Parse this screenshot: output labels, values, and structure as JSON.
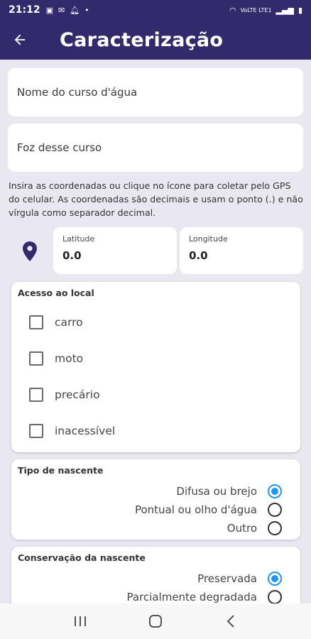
{
  "status_bar": {
    "time": "21:12",
    "network": "VoLTE LTE1"
  },
  "app_bar": {
    "title": "Caracterização",
    "back_icon": "arrow-left-icon"
  },
  "form": {
    "river_name_placeholder": "Nome do curso d'água",
    "mouth_placeholder": "Foz desse curso",
    "coordinates_info": "Insira as coordenadas ou clique no ícone para coletar pelo GPS do celular. As coordenadas são decimais e usam o ponto (.) e não vírgula como separador decimal.",
    "latitude": {
      "label": "Latitude",
      "value": "0.0"
    },
    "longitude": {
      "label": "Longitude",
      "value": "0.0"
    }
  },
  "access": {
    "title": "Acesso ao local",
    "options": [
      {
        "label": "carro",
        "checked": false
      },
      {
        "label": "moto",
        "checked": false
      },
      {
        "label": "precário",
        "checked": false
      },
      {
        "label": "inacessível",
        "checked": false
      }
    ]
  },
  "spring_type": {
    "title": "Tipo de nascente",
    "options": [
      {
        "label": "Difusa ou brejo",
        "selected": true
      },
      {
        "label": "Pontual ou olho d'água",
        "selected": false
      },
      {
        "label": "Outro",
        "selected": false
      }
    ]
  },
  "conservation": {
    "title": "Conservação da nascente",
    "options": [
      {
        "label": "Preservada",
        "selected": true
      },
      {
        "label": "Parcialmente degradada",
        "selected": false
      }
    ]
  },
  "colors": {
    "primary": "#332a6b",
    "accent": "#2196f3",
    "background": "#e9e8f1"
  }
}
